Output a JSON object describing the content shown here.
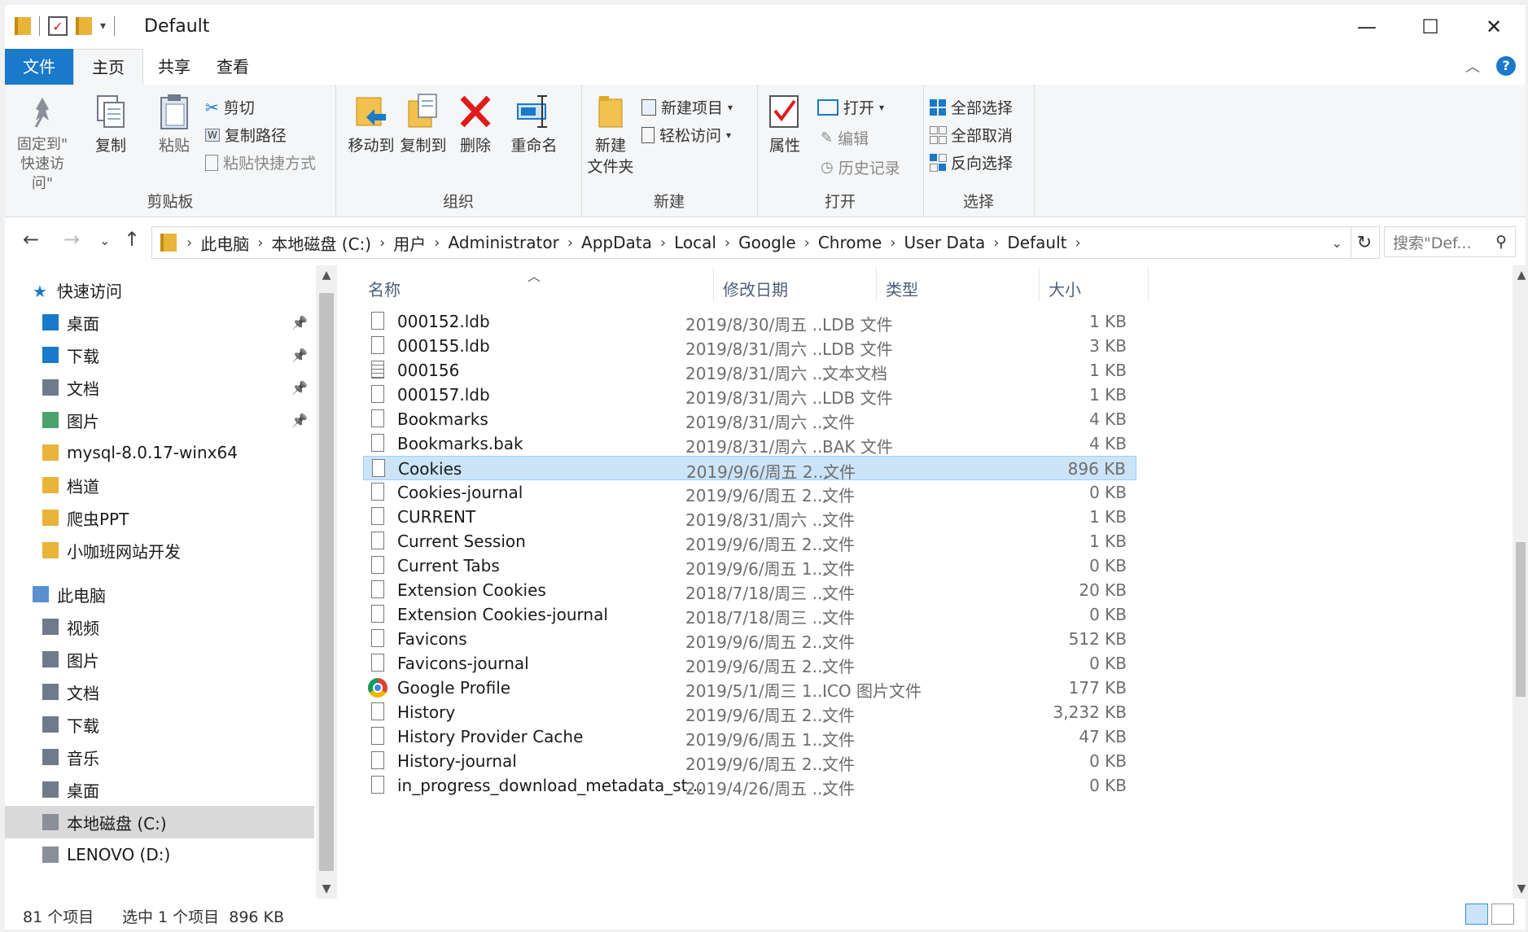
{
  "window": {
    "title": "Default",
    "controls": {
      "minimize": "—",
      "maximize": "☐",
      "close": "✕"
    }
  },
  "ribbon_tabs": {
    "file": "文件",
    "home": "主页",
    "share": "共享",
    "view": "查看"
  },
  "ribbon": {
    "clipboard": {
      "label": "剪贴板",
      "pin": "固定到\"\n快速访问\"",
      "copy": "复制",
      "paste": "粘贴",
      "cut": "剪切",
      "copy_path": "复制路径",
      "paste_shortcut": "粘贴快捷方式"
    },
    "organize": {
      "label": "组织",
      "move_to": "移动到",
      "copy_to": "复制到",
      "delete": "删除",
      "rename": "重命名"
    },
    "new": {
      "label": "新建",
      "new_folder_line1": "新建",
      "new_folder_line2": "文件夹",
      "new_item": "新建项目",
      "easy_access": "轻松访问"
    },
    "open": {
      "label": "打开",
      "properties": "属性",
      "open": "打开",
      "edit": "编辑",
      "history": "历史记录"
    },
    "select": {
      "label": "选择",
      "select_all": "全部选择",
      "select_none": "全部取消",
      "invert": "反向选择"
    }
  },
  "address": {
    "crumbs": [
      "此电脑",
      "本地磁盘 (C:)",
      "用户",
      "Administrator",
      "AppData",
      "Local",
      "Google",
      "Chrome",
      "User Data",
      "Default"
    ],
    "search_placeholder": "搜索\"Def..."
  },
  "nav": {
    "quick_access": "快速访问",
    "quick_items": [
      "桌面",
      "下载",
      "文档",
      "图片",
      "mysql-8.0.17-winx64",
      "档道",
      "爬虫PPT",
      "小咖班网站开发"
    ],
    "this_pc": "此电脑",
    "pc_items": [
      "视频",
      "图片",
      "文档",
      "下载",
      "音乐",
      "桌面",
      "本地磁盘 (C:)",
      "LENOVO (D:)"
    ]
  },
  "columns": {
    "name": "名称",
    "date": "修改日期",
    "type": "类型",
    "size": "大小"
  },
  "files": [
    {
      "name": "000152.ldb",
      "date": "2019/8/30/周五 ...",
      "type": "LDB 文件",
      "size": "1 KB",
      "icon": "file"
    },
    {
      "name": "000155.ldb",
      "date": "2019/8/31/周六 ...",
      "type": "LDB 文件",
      "size": "3 KB",
      "icon": "file"
    },
    {
      "name": "000156",
      "date": "2019/8/31/周六 ...",
      "type": "文本文档",
      "size": "1 KB",
      "icon": "txt"
    },
    {
      "name": "000157.ldb",
      "date": "2019/8/31/周六 ...",
      "type": "LDB 文件",
      "size": "1 KB",
      "icon": "file"
    },
    {
      "name": "Bookmarks",
      "date": "2019/8/31/周六 ...",
      "type": "文件",
      "size": "4 KB",
      "icon": "file"
    },
    {
      "name": "Bookmarks.bak",
      "date": "2019/8/31/周六 ...",
      "type": "BAK 文件",
      "size": "4 KB",
      "icon": "file"
    },
    {
      "name": "Cookies",
      "date": "2019/9/6/周五 2...",
      "type": "文件",
      "size": "896 KB",
      "icon": "file",
      "selected": true
    },
    {
      "name": "Cookies-journal",
      "date": "2019/9/6/周五 2...",
      "type": "文件",
      "size": "0 KB",
      "icon": "file"
    },
    {
      "name": "CURRENT",
      "date": "2019/8/31/周六 ...",
      "type": "文件",
      "size": "1 KB",
      "icon": "file"
    },
    {
      "name": "Current Session",
      "date": "2019/9/6/周五 2...",
      "type": "文件",
      "size": "1 KB",
      "icon": "file"
    },
    {
      "name": "Current Tabs",
      "date": "2019/9/6/周五 1...",
      "type": "文件",
      "size": "0 KB",
      "icon": "file"
    },
    {
      "name": "Extension Cookies",
      "date": "2018/7/18/周三 ...",
      "type": "文件",
      "size": "20 KB",
      "icon": "file"
    },
    {
      "name": "Extension Cookies-journal",
      "date": "2018/7/18/周三 ...",
      "type": "文件",
      "size": "0 KB",
      "icon": "file"
    },
    {
      "name": "Favicons",
      "date": "2019/9/6/周五 2...",
      "type": "文件",
      "size": "512 KB",
      "icon": "file"
    },
    {
      "name": "Favicons-journal",
      "date": "2019/9/6/周五 2...",
      "type": "文件",
      "size": "0 KB",
      "icon": "file"
    },
    {
      "name": "Google Profile",
      "date": "2019/5/1/周三 1...",
      "type": "ICO 图片文件",
      "size": "177 KB",
      "icon": "chrome"
    },
    {
      "name": "History",
      "date": "2019/9/6/周五 2...",
      "type": "文件",
      "size": "3,232 KB",
      "icon": "file"
    },
    {
      "name": "History Provider Cache",
      "date": "2019/9/6/周五 1...",
      "type": "文件",
      "size": "47 KB",
      "icon": "file"
    },
    {
      "name": "History-journal",
      "date": "2019/9/6/周五 2...",
      "type": "文件",
      "size": "0 KB",
      "icon": "file"
    },
    {
      "name": "in_progress_download_metadata_st...",
      "date": "2019/4/26/周五 ...",
      "type": "文件",
      "size": "0 KB",
      "icon": "file"
    }
  ],
  "status": {
    "count": "81 个项目",
    "selection": "选中 1 个项目  896 KB"
  }
}
